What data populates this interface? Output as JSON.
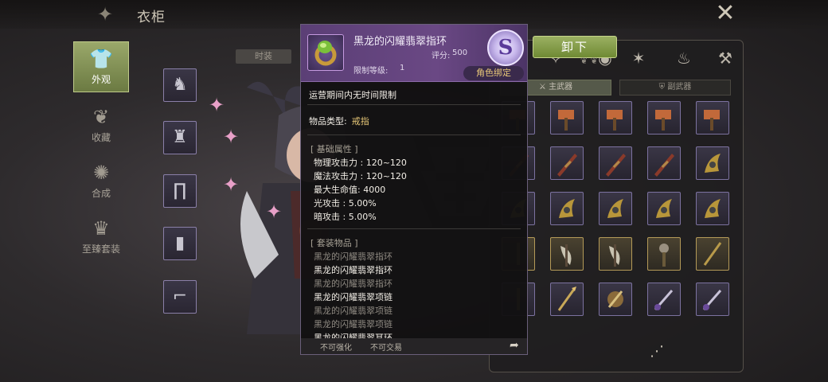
{
  "header": {
    "title": "衣柜"
  },
  "nav": [
    {
      "label": "外观",
      "icon": "outfit-icon",
      "active": true
    },
    {
      "label": "收藏",
      "icon": "collection-icon",
      "active": false
    },
    {
      "label": "合成",
      "icon": "synthesis-icon",
      "active": false
    },
    {
      "label": "至臻套装",
      "icon": "premium-set-icon",
      "active": false
    }
  ],
  "fashion_tab": "时装",
  "equip_slots": [
    "headwear-slot",
    "top-slot",
    "pants-slot",
    "belt-slot",
    "shoes-slot"
  ],
  "tooltip": {
    "name": "黑龙的闪耀翡翠指环",
    "score_label": "评分:",
    "score_value": "500",
    "level_label": "限制等级:",
    "level_value": "1",
    "rank": "S",
    "bind": "角色绑定",
    "duration": "运营期间内无时间限制",
    "type_label": "物品类型:",
    "type_value": "戒指",
    "basic_header": "[ 基础属性 ]",
    "attributes": [
      "物理攻击力 : 120~120",
      "魔法攻击力 : 120~120",
      "最大生命值:   4000",
      "光攻击 : 5.00%",
      "暗攻击 : 5.00%"
    ],
    "set_header": "[ 套装物品 ]",
    "set_items": [
      {
        "name": "黑龙的闪耀翡翠指环",
        "owned": false
      },
      {
        "name": "黑龙的闪耀翡翠指环",
        "owned": true
      },
      {
        "name": "黑龙的闪耀翡翠指环",
        "owned": false
      },
      {
        "name": "黑龙的闪耀翡翠项链",
        "owned": true
      },
      {
        "name": "黑龙的闪耀翡翠项链",
        "owned": false
      },
      {
        "name": "黑龙的闪耀翡翠项链",
        "owned": false
      },
      {
        "name": "黑龙的闪耀翡翠耳环",
        "owned": true
      }
    ],
    "footer_no_enhance": "不可强化",
    "footer_no_trade": "不可交易"
  },
  "unequip_label": "卸下",
  "weapon_tabs": {
    "main": "主武器",
    "sub": "副武器"
  },
  "category_icons": [
    "armor-category-icon",
    "accessory-category-icon",
    "ring-category-icon",
    "flame-category-icon",
    "fire-category-icon",
    "tools-category-icon"
  ],
  "grid": [
    [
      "hammer",
      "hammer",
      "hammer",
      "hammer",
      "hammer"
    ],
    [
      "blade",
      "blade",
      "blade",
      "blade",
      "claw"
    ],
    [
      "claw",
      "claw",
      "claw",
      "claw",
      "claw"
    ],
    [
      "rod",
      "axe",
      "axe",
      "mace",
      "staff"
    ],
    [
      "rod",
      "spear",
      "shield-blade",
      "sword",
      "sword"
    ]
  ],
  "grid_gold_row": 3,
  "colors": {
    "accent_green": "#8aa24e",
    "rare_purple": "#6a4884",
    "gold_text": "#e8c878"
  }
}
